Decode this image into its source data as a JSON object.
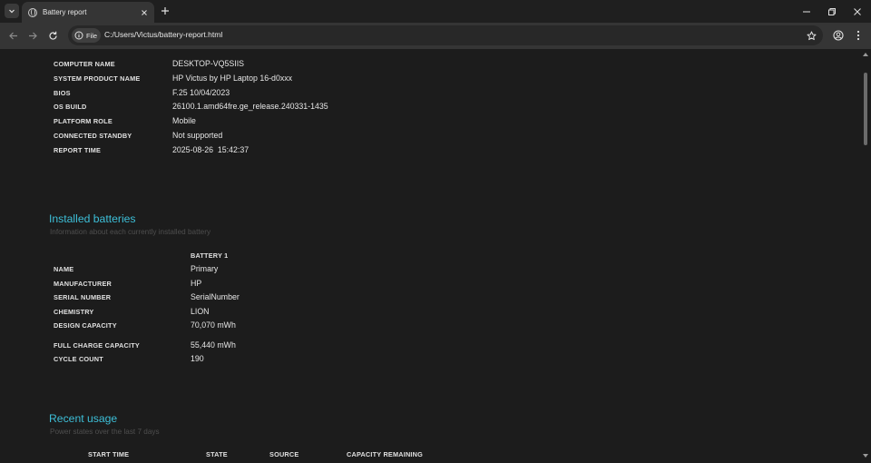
{
  "browser": {
    "tab_title": "Battery report",
    "url_chip": "File",
    "url": "C:/Users/Victus/battery-report.html"
  },
  "system_info": [
    {
      "label": "COMPUTER NAME",
      "value": "DESKTOP-VQ5SIIS"
    },
    {
      "label": "SYSTEM PRODUCT NAME",
      "value": "HP Victus by HP Laptop 16-d0xxx"
    },
    {
      "label": "BIOS",
      "value": "F.25 10/04/2023"
    },
    {
      "label": "OS BUILD",
      "value": "26100.1.amd64fre.ge_release.240331-1435"
    },
    {
      "label": "PLATFORM ROLE",
      "value": "Mobile"
    },
    {
      "label": "CONNECTED STANDBY",
      "value": "Not supported"
    },
    {
      "label": "REPORT TIME",
      "value": "2025-08-26  15:42:37"
    }
  ],
  "installed_batteries": {
    "title": "Installed batteries",
    "subtitle": "Information about each currently installed battery",
    "column_header": "BATTERY 1",
    "rows": [
      {
        "label": "NAME",
        "value": "Primary"
      },
      {
        "label": "MANUFACTURER",
        "value": "HP"
      },
      {
        "label": "SERIAL NUMBER",
        "value": "SerialNumber"
      },
      {
        "label": "CHEMISTRY",
        "value": "LION"
      },
      {
        "label": "DESIGN CAPACITY",
        "value": "70,070 mWh"
      },
      {
        "label": "FULL CHARGE CAPACITY",
        "value": "55,440 mWh"
      },
      {
        "label": "CYCLE COUNT",
        "value": "190"
      }
    ]
  },
  "recent_usage": {
    "title": "Recent usage",
    "subtitle": "Power states over the last 7 days",
    "columns": [
      "START TIME",
      "STATE",
      "SOURCE",
      "CAPACITY REMAINING"
    ]
  },
  "colors": {
    "accent": "#3dbfd8",
    "background": "#1c1c1c"
  },
  "icons": [
    "tab-search-icon",
    "globe-icon",
    "close-icon",
    "plus-icon",
    "minimize-icon",
    "restore-icon",
    "back-icon",
    "forward-icon",
    "reload-icon",
    "info-icon",
    "star-icon",
    "profile-icon",
    "menu-icon"
  ]
}
